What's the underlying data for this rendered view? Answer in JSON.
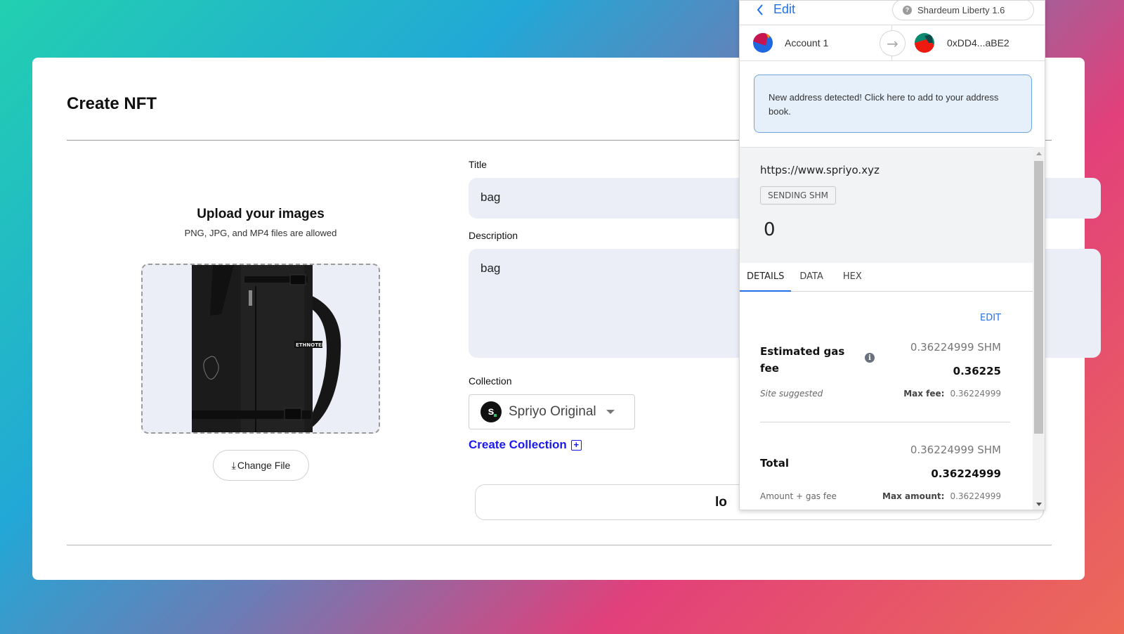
{
  "page": {
    "title": "Create NFT",
    "upload": {
      "title": "Upload your images",
      "subtitle": "PNG, JPG, and MP4 files are allowed",
      "image_label": "ETHNOTEK",
      "change_file_icon": "upload-icon",
      "change_file_label": "Change File"
    },
    "form": {
      "title_label": "Title",
      "title_value": "bag",
      "description_label": "Description",
      "description_value": "bag",
      "collection_label": "Collection",
      "collection_logo_letter": "s",
      "collection_value": "Spriyo Original",
      "create_collection_label": "Create Collection",
      "create_collection_icon": "plus-square-icon",
      "submit_label": "lo"
    }
  },
  "wallet": {
    "back_label": "Edit",
    "network": "Shardeum Liberty 1.6",
    "from_account": "Account 1",
    "to_address": "0xDD4...aBE2",
    "notice": "New address detected! Click here to add to your address book.",
    "origin": "https://www.spriyo.xyz",
    "badge": "SENDING SHM",
    "amount": "0",
    "tabs": [
      {
        "label": "DETAILS",
        "active": true
      },
      {
        "label": "DATA",
        "active": false
      },
      {
        "label": "HEX",
        "active": false
      }
    ],
    "edit_label": "EDIT",
    "gas": {
      "label": "Estimated gas fee",
      "value_shm": "0.36224999 SHM",
      "value_main": "0.36225",
      "note": "Site suggested",
      "max_label": "Max fee:",
      "max_value": "0.36224999"
    },
    "total": {
      "label": "Total",
      "value_shm": "0.36224999 SHM",
      "value_main": "0.36224999",
      "note": "Amount + gas fee",
      "max_label": "Max amount:",
      "max_value": "0.36224999"
    },
    "colors": {
      "accent": "#1f72e8",
      "notice_bg": "#e6f0fa",
      "link": "#1a1aef"
    }
  }
}
